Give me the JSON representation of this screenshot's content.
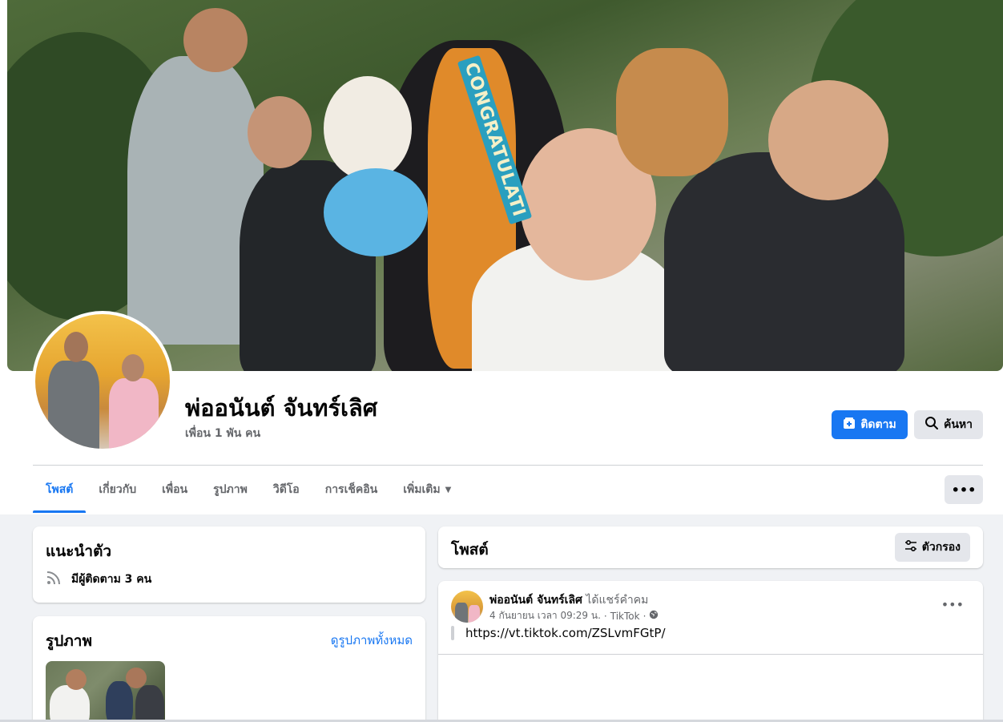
{
  "profile": {
    "name": "พ่ออนันต์ จันทร์เลิศ",
    "friends": "เพื่อน 1 พัน คน"
  },
  "cover": {
    "sash_text": "CONGRATULATI"
  },
  "actions": {
    "follow_label": "ติดตาม",
    "search_label": "ค้นหา",
    "more_label": "•••"
  },
  "tabs": [
    {
      "label": "โพสต์",
      "active": true
    },
    {
      "label": "เกี่ยวกับ",
      "active": false
    },
    {
      "label": "เพื่อน",
      "active": false
    },
    {
      "label": "รูปภาพ",
      "active": false
    },
    {
      "label": "วิดีโอ",
      "active": false
    },
    {
      "label": "การเช็คอิน",
      "active": false
    },
    {
      "label": "เพิ่มเติม",
      "active": false
    }
  ],
  "intro": {
    "title": "แนะนำตัว",
    "followers_text": "มีผู้ติดตาม 3 คน"
  },
  "photos": {
    "title": "รูปภาพ",
    "see_all": "ดูรูปภาพทั้งหมด"
  },
  "posts_header": {
    "title": "โพสต์",
    "filter_label": "ตัวกรอง"
  },
  "post": {
    "author": "พ่ออนันต์ จันทร์เลิศ",
    "action": "ได้แชร์คำคม",
    "date": "4 กันยายน เวลา 09:29 น.",
    "source": "TikTok",
    "link": "https://vt.tiktok.com/ZSLvmFGtP/",
    "menu_label": "•••"
  },
  "colors": {
    "accent": "#1877f2",
    "background": "#f0f2f5",
    "secondary_button": "#e4e6eb",
    "muted_text": "#65676b"
  }
}
